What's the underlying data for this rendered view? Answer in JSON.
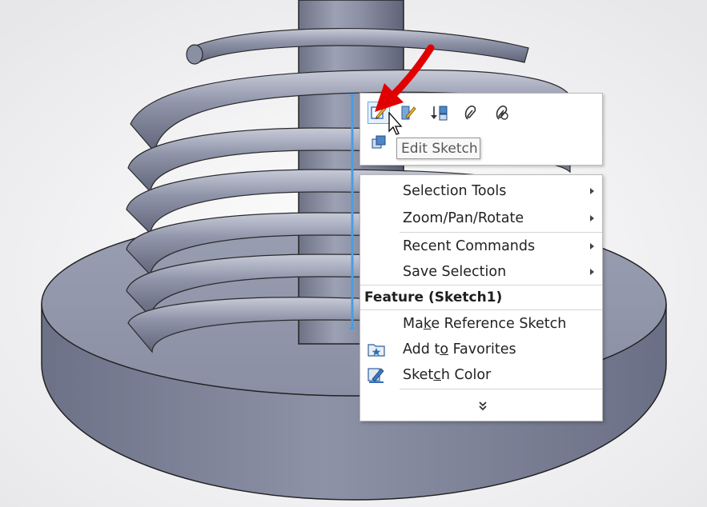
{
  "toolbar": {
    "icons": [
      "edit-sketch-icon",
      "edit-feature-icon",
      "rollback-icon",
      "hide-components-icon",
      "isolate-icon",
      "select-other-icon"
    ],
    "tooltip": "Edit Sketch"
  },
  "menu": {
    "items": [
      {
        "label": "Selection Tools",
        "has_submenu": true
      },
      {
        "label": "Zoom/Pan/Rotate",
        "has_submenu": true
      },
      {
        "label": "Recent Commands",
        "has_submenu": true,
        "accelerator": "R"
      },
      {
        "label": "Save Selection",
        "has_submenu": true
      }
    ],
    "section_header": "Feature (Sketch1)",
    "feature_items": [
      {
        "label_pre": "Ma",
        "label_accel": "k",
        "label_post": "e Reference Sketch",
        "icon": ""
      },
      {
        "label_pre": "Add t",
        "label_accel": "o",
        "label_post": " Favorites",
        "icon": "favorites-folder-icon"
      },
      {
        "label_pre": "Sket",
        "label_accel": "c",
        "label_post": "h Color",
        "icon": "sketch-color-icon"
      }
    ],
    "expand_icon": "double-chevron-down-icon"
  },
  "colors": {
    "model_face": "#8e93a7",
    "model_dark": "#5f6479",
    "annotation_arrow": "#e00000",
    "highlight": "#4a9ee3"
  }
}
